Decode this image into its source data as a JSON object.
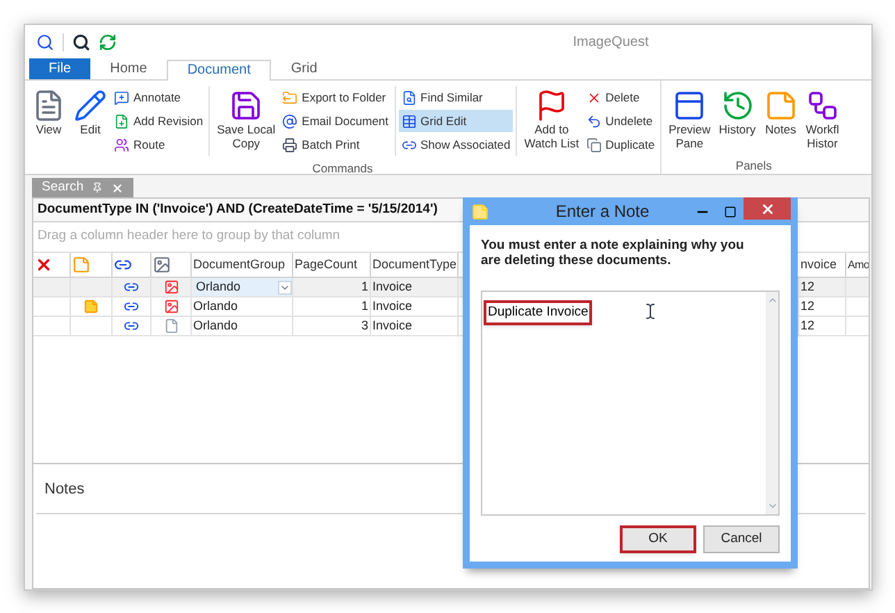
{
  "window": {
    "title": "ImageQuest"
  },
  "ribbon": {
    "tabs": [
      {
        "label": "File",
        "kind": "file",
        "selected": false
      },
      {
        "label": "Home",
        "kind": "tab",
        "selected": false
      },
      {
        "label": "Document",
        "kind": "tab",
        "selected": true
      },
      {
        "label": "Grid",
        "kind": "tab",
        "selected": false
      }
    ],
    "sections": [
      {
        "label": "Commands",
        "clusters": [
          {
            "columns": [
              {
                "kind": "large",
                "lines": [
                  "View"
                ]
              },
              {
                "kind": "large",
                "lines": [
                  "Edit"
                ]
              },
              {
                "kind": "small",
                "items": [
                  {
                    "label": "Annotate",
                    "selected": false
                  },
                  {
                    "label": "Add Revision",
                    "selected": false
                  },
                  {
                    "label": "Route",
                    "selected": false
                  }
                ]
              }
            ]
          },
          {
            "columns": [
              {
                "kind": "large",
                "lines": [
                  "Save Local",
                  "Copy"
                ]
              },
              {
                "kind": "small",
                "items": [
                  {
                    "label": "Export to Folder",
                    "selected": false
                  },
                  {
                    "label": "Email Document",
                    "selected": false
                  },
                  {
                    "label": "Batch Print",
                    "selected": false
                  }
                ]
              }
            ]
          },
          {
            "columns": [
              {
                "kind": "small",
                "items": [
                  {
                    "label": "Find Similar",
                    "selected": false
                  },
                  {
                    "label": "Grid Edit",
                    "selected": true
                  },
                  {
                    "label": "Show Associated",
                    "selected": false
                  }
                ]
              }
            ]
          },
          {
            "columns": [
              {
                "kind": "large",
                "lines": [
                  "Add to",
                  "Watch List"
                ]
              },
              {
                "kind": "small",
                "items": [
                  {
                    "label": "Delete",
                    "selected": false
                  },
                  {
                    "label": "Undelete",
                    "selected": false
                  },
                  {
                    "label": "Duplicate",
                    "selected": false
                  }
                ]
              }
            ]
          }
        ]
      },
      {
        "label": "Panels",
        "clusters": [
          {
            "columns": [
              {
                "kind": "large",
                "lines": [
                  "Preview",
                  "Pane"
                ]
              },
              {
                "kind": "large",
                "lines": [
                  "History"
                ]
              },
              {
                "kind": "large",
                "lines": [
                  "Notes"
                ]
              },
              {
                "kind": "large",
                "lines": [
                  "Workfl",
                  "Histor"
                ]
              }
            ]
          }
        ]
      }
    ]
  },
  "search_tab": {
    "label": "Search"
  },
  "query": "DocumentType IN ('Invoice') AND (CreateDateTime = '5/15/2014')",
  "group_hint": "Drag a column header here to group by that column",
  "grid": {
    "columns": [
      {
        "kind": "delete"
      },
      {
        "kind": "note"
      },
      {
        "kind": "link"
      },
      {
        "kind": "thumbnail"
      },
      {
        "kind": "text",
        "label": "DocumentGroup"
      },
      {
        "kind": "text",
        "label": "PageCount"
      },
      {
        "kind": "text",
        "label": "DocumentType"
      },
      {
        "kind": "hidden"
      },
      {
        "kind": "text",
        "label": "nvoice"
      },
      {
        "kind": "text",
        "label": "Amo"
      }
    ],
    "rows": [
      {
        "selected": true,
        "has_note": false,
        "has_image": true,
        "document_group": "Orlando",
        "editing": true,
        "page_count": "1",
        "document_type": "Invoice",
        "column_9": "12"
      },
      {
        "selected": false,
        "has_note": true,
        "has_image": true,
        "document_group": "Orlando",
        "editing": false,
        "page_count": "1",
        "document_type": "Invoice",
        "column_9": "12"
      },
      {
        "selected": false,
        "has_note": false,
        "has_image": false,
        "document_group": "Orlando",
        "editing": false,
        "page_count": "3",
        "document_type": "Invoice",
        "column_9": "12"
      }
    ]
  },
  "notes_panel": {
    "title": "Notes"
  },
  "dialog": {
    "title": "Enter a Note",
    "message": "You must enter a note explaining why you are deleting these documents.",
    "note": {
      "value": "Duplicate Invoice",
      "highlighted": true
    },
    "buttons": [
      {
        "label": "OK",
        "highlighted": true
      },
      {
        "label": "Cancel",
        "highlighted": false
      }
    ]
  }
}
